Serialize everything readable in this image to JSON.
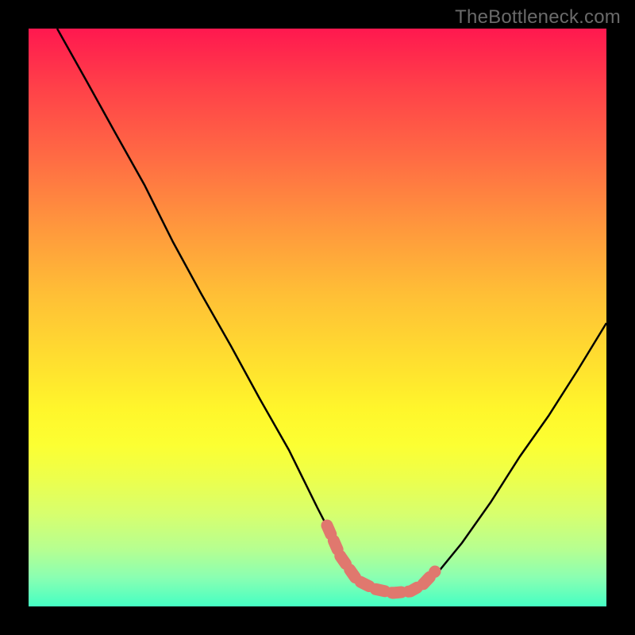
{
  "watermark": "TheBottleneck.com",
  "colors": {
    "background": "#000000",
    "curve": "#000000",
    "marker": "#e0786e",
    "gradient_stops": [
      "#ff184f",
      "#ff4049",
      "#ff6a44",
      "#ff963d",
      "#ffbf36",
      "#ffe02f",
      "#fff62b",
      "#fcff32",
      "#ecff4d",
      "#d7ff6e",
      "#b7ff90",
      "#8affb2",
      "#45ffc3"
    ]
  },
  "chart_data": {
    "type": "line",
    "title": "",
    "xlabel": "",
    "ylabel": "",
    "xlim": [
      0,
      100
    ],
    "ylim": [
      0,
      100
    ],
    "x": [
      5,
      10,
      15,
      20,
      25,
      30,
      35,
      40,
      45,
      50,
      52,
      55,
      58,
      60,
      63,
      66,
      68,
      70,
      75,
      80,
      85,
      90,
      95,
      100
    ],
    "values": [
      100,
      91,
      82,
      73,
      63,
      54,
      45,
      36,
      27,
      17,
      13,
      7,
      4,
      3,
      2,
      2,
      3,
      5,
      11,
      18,
      26,
      33,
      41,
      49
    ],
    "optimum_band": {
      "x_start": 52,
      "x_end": 70,
      "y_min": 2,
      "y_max": 9
    },
    "annotations": []
  }
}
